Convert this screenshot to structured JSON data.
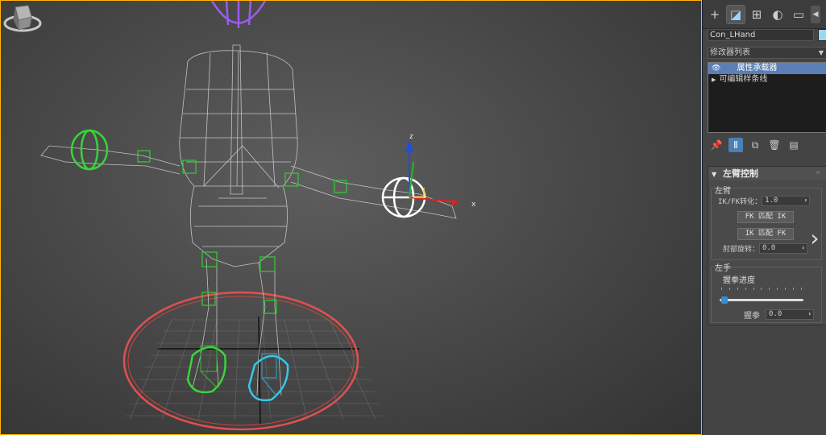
{
  "viewport": {
    "axis_x_label": "x",
    "axis_z_label": "z"
  },
  "panel": {
    "tabs": [
      {
        "icon": "create-icon",
        "glyph": "+"
      },
      {
        "icon": "modify-icon",
        "glyph": "◪"
      },
      {
        "icon": "hierarchy-icon",
        "glyph": "⊞"
      },
      {
        "icon": "motion-icon",
        "glyph": "◐"
      },
      {
        "icon": "display-icon",
        "glyph": "▭"
      },
      {
        "icon": "tab-scroll-left-icon",
        "glyph": "◀"
      }
    ],
    "object_name": "Con_LHand",
    "swatch_color": "#9ad8f0",
    "modifier_list_label": "修改器列表",
    "stack_items": [
      {
        "label": "属性承载器",
        "selected": true
      },
      {
        "label": "可编辑样条线",
        "selected": false
      }
    ],
    "rollout": {
      "title": "左臂控制",
      "arm_group_label": "左臂",
      "ikfk_label": "IK/FK转化：",
      "ikfk_value": "1.0",
      "fk_match_ik": "FK 匹配 IK",
      "ik_match_fk": "IK 匹配 FK",
      "elbow_label": "肘部旋转：",
      "elbow_value": "0.0",
      "hand_group_label": "左手",
      "fist_progress_label": "握拳进度",
      "fist_progress": 0.02,
      "fist_label": "握拳",
      "fist_value": "0.0"
    }
  },
  "colors": {
    "selection_accent": "#5b7fb5",
    "viewport_border": "#ffb400"
  }
}
